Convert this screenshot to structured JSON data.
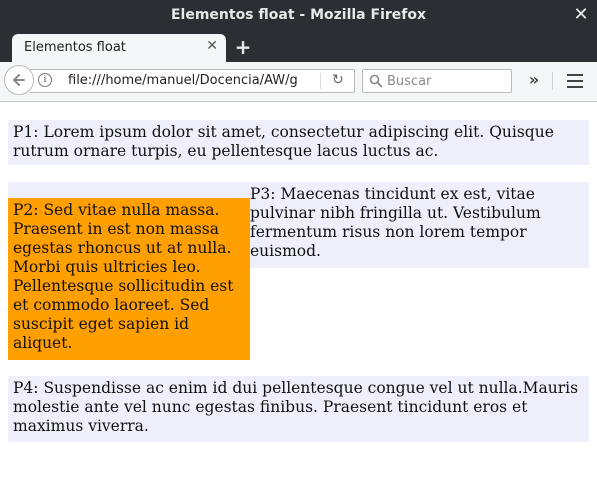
{
  "window": {
    "title": "Elementos float - Mozilla Firefox",
    "close_glyph": "✕"
  },
  "tabs": [
    {
      "label": "Elementos float",
      "close_glyph": "✕"
    }
  ],
  "new_tab_glyph": "+",
  "navbar": {
    "url": "file:///home/manuel/Docencia/AW/g",
    "search_placeholder": "Buscar",
    "overflow_glyph": "»",
    "reload_glyph": "↻"
  },
  "content": {
    "p1": "P1: Lorem ipsum dolor sit amet, consectetur adipiscing elit. Quisque rutrum ornare turpis, eu pellentesque lacus luctus ac.",
    "p2": "P2: Sed vitae nulla massa. Praesent in est non massa egestas rhoncus ut at nulla. Morbi quis ultricies leo. Pellentesque sollicitudin est et commodo laoreet. Sed suscipit eget sapien id aliquet.",
    "p3": "P3: Maecenas tincidunt ex est, vitae pulvinar nibh fringilla ut. Vestibulum fermentum risus non lorem tempor euismod.",
    "p4": "P4: Suspendisse ac enim id dui pellentesque congue vel ut nulla.Mauris molestie ante vel nunc egestas finibus. Praesent tincidunt eros et maximus viverra."
  },
  "colors": {
    "titlebar": "#2b2e33",
    "float_box": "#ff9f00",
    "paragraph_bg": "#efeffc"
  }
}
